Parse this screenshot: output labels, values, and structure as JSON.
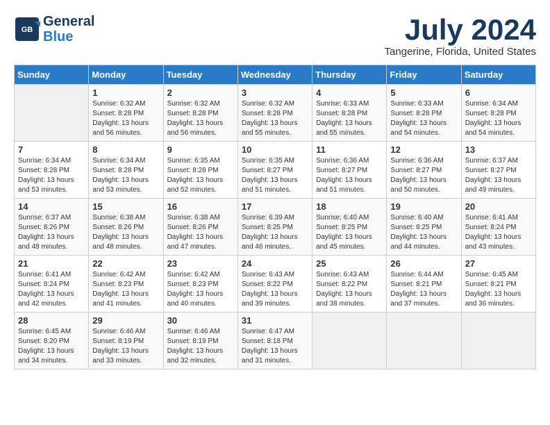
{
  "logo": {
    "line1": "General",
    "line2": "Blue"
  },
  "title": "July 2024",
  "location": "Tangerine, Florida, United States",
  "headers": [
    "Sunday",
    "Monday",
    "Tuesday",
    "Wednesday",
    "Thursday",
    "Friday",
    "Saturday"
  ],
  "weeks": [
    [
      {
        "day": "",
        "info": ""
      },
      {
        "day": "1",
        "info": "Sunrise: 6:32 AM\nSunset: 8:28 PM\nDaylight: 13 hours\nand 56 minutes."
      },
      {
        "day": "2",
        "info": "Sunrise: 6:32 AM\nSunset: 8:28 PM\nDaylight: 13 hours\nand 56 minutes."
      },
      {
        "day": "3",
        "info": "Sunrise: 6:32 AM\nSunset: 8:28 PM\nDaylight: 13 hours\nand 55 minutes."
      },
      {
        "day": "4",
        "info": "Sunrise: 6:33 AM\nSunset: 8:28 PM\nDaylight: 13 hours\nand 55 minutes."
      },
      {
        "day": "5",
        "info": "Sunrise: 6:33 AM\nSunset: 8:28 PM\nDaylight: 13 hours\nand 54 minutes."
      },
      {
        "day": "6",
        "info": "Sunrise: 6:34 AM\nSunset: 8:28 PM\nDaylight: 13 hours\nand 54 minutes."
      }
    ],
    [
      {
        "day": "7",
        "info": "Sunrise: 6:34 AM\nSunset: 8:28 PM\nDaylight: 13 hours\nand 53 minutes."
      },
      {
        "day": "8",
        "info": "Sunrise: 6:34 AM\nSunset: 8:28 PM\nDaylight: 13 hours\nand 53 minutes."
      },
      {
        "day": "9",
        "info": "Sunrise: 6:35 AM\nSunset: 8:28 PM\nDaylight: 13 hours\nand 52 minutes."
      },
      {
        "day": "10",
        "info": "Sunrise: 6:35 AM\nSunset: 8:27 PM\nDaylight: 13 hours\nand 51 minutes."
      },
      {
        "day": "11",
        "info": "Sunrise: 6:36 AM\nSunset: 8:27 PM\nDaylight: 13 hours\nand 51 minutes."
      },
      {
        "day": "12",
        "info": "Sunrise: 6:36 AM\nSunset: 8:27 PM\nDaylight: 13 hours\nand 50 minutes."
      },
      {
        "day": "13",
        "info": "Sunrise: 6:37 AM\nSunset: 8:27 PM\nDaylight: 13 hours\nand 49 minutes."
      }
    ],
    [
      {
        "day": "14",
        "info": "Sunrise: 6:37 AM\nSunset: 8:26 PM\nDaylight: 13 hours\nand 48 minutes."
      },
      {
        "day": "15",
        "info": "Sunrise: 6:38 AM\nSunset: 8:26 PM\nDaylight: 13 hours\nand 48 minutes."
      },
      {
        "day": "16",
        "info": "Sunrise: 6:38 AM\nSunset: 8:26 PM\nDaylight: 13 hours\nand 47 minutes."
      },
      {
        "day": "17",
        "info": "Sunrise: 6:39 AM\nSunset: 8:25 PM\nDaylight: 13 hours\nand 46 minutes."
      },
      {
        "day": "18",
        "info": "Sunrise: 6:40 AM\nSunset: 8:25 PM\nDaylight: 13 hours\nand 45 minutes."
      },
      {
        "day": "19",
        "info": "Sunrise: 6:40 AM\nSunset: 8:25 PM\nDaylight: 13 hours\nand 44 minutes."
      },
      {
        "day": "20",
        "info": "Sunrise: 6:41 AM\nSunset: 8:24 PM\nDaylight: 13 hours\nand 43 minutes."
      }
    ],
    [
      {
        "day": "21",
        "info": "Sunrise: 6:41 AM\nSunset: 8:24 PM\nDaylight: 13 hours\nand 42 minutes."
      },
      {
        "day": "22",
        "info": "Sunrise: 6:42 AM\nSunset: 8:23 PM\nDaylight: 13 hours\nand 41 minutes."
      },
      {
        "day": "23",
        "info": "Sunrise: 6:42 AM\nSunset: 8:23 PM\nDaylight: 13 hours\nand 40 minutes."
      },
      {
        "day": "24",
        "info": "Sunrise: 6:43 AM\nSunset: 8:22 PM\nDaylight: 13 hours\nand 39 minutes."
      },
      {
        "day": "25",
        "info": "Sunrise: 6:43 AM\nSunset: 8:22 PM\nDaylight: 13 hours\nand 38 minutes."
      },
      {
        "day": "26",
        "info": "Sunrise: 6:44 AM\nSunset: 8:21 PM\nDaylight: 13 hours\nand 37 minutes."
      },
      {
        "day": "27",
        "info": "Sunrise: 6:45 AM\nSunset: 8:21 PM\nDaylight: 13 hours\nand 36 minutes."
      }
    ],
    [
      {
        "day": "28",
        "info": "Sunrise: 6:45 AM\nSunset: 8:20 PM\nDaylight: 13 hours\nand 34 minutes."
      },
      {
        "day": "29",
        "info": "Sunrise: 6:46 AM\nSunset: 8:19 PM\nDaylight: 13 hours\nand 33 minutes."
      },
      {
        "day": "30",
        "info": "Sunrise: 6:46 AM\nSunset: 8:19 PM\nDaylight: 13 hours\nand 32 minutes."
      },
      {
        "day": "31",
        "info": "Sunrise: 6:47 AM\nSunset: 8:18 PM\nDaylight: 13 hours\nand 31 minutes."
      },
      {
        "day": "",
        "info": ""
      },
      {
        "day": "",
        "info": ""
      },
      {
        "day": "",
        "info": ""
      }
    ]
  ]
}
